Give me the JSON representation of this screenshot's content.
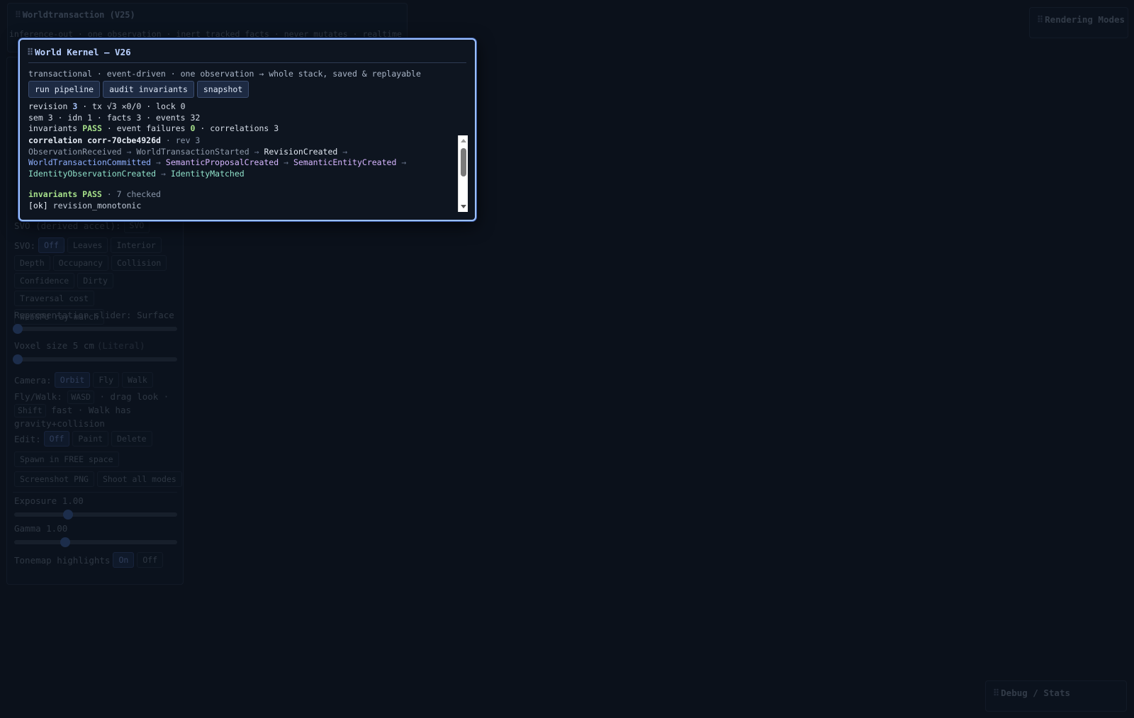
{
  "background": {
    "stacked_titles": "Worldtransaction (V25)",
    "stacked_subtitle": "inference-out · one observation · inert tracked facts · never mutates · realtime · inventory",
    "section_label": "Se"
  },
  "left_panel": {
    "svo_derived_label": "SVO (derived accel):",
    "svo_derived_chip": "SVO",
    "svo_label": "SVO:",
    "svo_modes": [
      "Off",
      "Leaves",
      "Interior"
    ],
    "svo_modes_2": [
      "Depth",
      "Occupancy",
      "Collision"
    ],
    "svo_modes_3": [
      "Confidence",
      "Dirty"
    ],
    "svo_modes_4": [
      "Traversal cost",
      "WebGPU ray-march"
    ],
    "representation_label": "Representation slider: Surface",
    "representation_value": 0.0,
    "voxel_size_label": "Voxel size 5 cm",
    "voxel_size_tag": "(Literal)",
    "voxel_size_value": 0.0,
    "camera_label": "Camera:",
    "camera_modes": [
      "Orbit",
      "Fly",
      "Walk"
    ],
    "flywalk_prefix": "Fly/Walk:",
    "flywalk_key1": "WASD",
    "flywalk_mid": "· drag look ·",
    "flywalk_key2": "Shift",
    "flywalk_suffix": "fast · Walk has gravity+collision",
    "edit_label": "Edit:",
    "edit_modes": [
      "Off",
      "Paint",
      "Delete"
    ],
    "spawn_button": "Spawn in FREE space",
    "screenshot_button": "Screenshot PNG",
    "shoot_all_button": "Shoot all modes",
    "exposure_label": "Exposure 1.00",
    "exposure_value": 0.33,
    "gamma_label": "Gamma 1.00",
    "gamma_value": 0.31,
    "tonemap_label": "Tonemap highlights",
    "tonemap_modes": [
      "On",
      "Off"
    ]
  },
  "rendering_modes": {
    "title": "Rendering Modes"
  },
  "debug_stats": {
    "title": "Debug / Stats"
  },
  "kernel": {
    "title": "World Kernel — V26",
    "subtitle": "transactional · event-driven · one observation → whole stack, saved & replayable",
    "buttons": {
      "run": "run pipeline",
      "audit": "audit invariants",
      "snapshot": "snapshot"
    },
    "stats": {
      "revision_label": "revision",
      "revision": "3",
      "tx_text": "· tx √3 ✕0/0 · lock 0",
      "line2": "sem 3 · idn 1 · facts 3 · events 32",
      "invariants_label": "invariants",
      "invariants_status": "PASS",
      "event_failures_label": "· event failures",
      "event_failures": "0",
      "correlations_text": "· correlations 3"
    },
    "log": {
      "corr_label": "correlation corr-70cbe4926d",
      "corr_rev": "· rev 3",
      "events": {
        "e1": "ObservationReceived",
        "e2": "WorldTransactionStarted",
        "e3": "RevisionCreated",
        "e4": "WorldTransactionCommitted",
        "e5": "SemanticProposalCreated",
        "e6": "SemanticEntityCreated",
        "e7": "IdentityObservationCreated",
        "e8": "IdentityMatched"
      },
      "arrow": "→",
      "inv_label": "invariants PASS",
      "inv_checked": "· 7 checked",
      "ok_tag": "[ok]",
      "ok_item": "revision_monotonic"
    }
  },
  "colors": {
    "background": "#0b111b",
    "panel_border_active": "#9cc0ff",
    "pass": "#a6e08a",
    "accent": "#8fb0ff"
  }
}
